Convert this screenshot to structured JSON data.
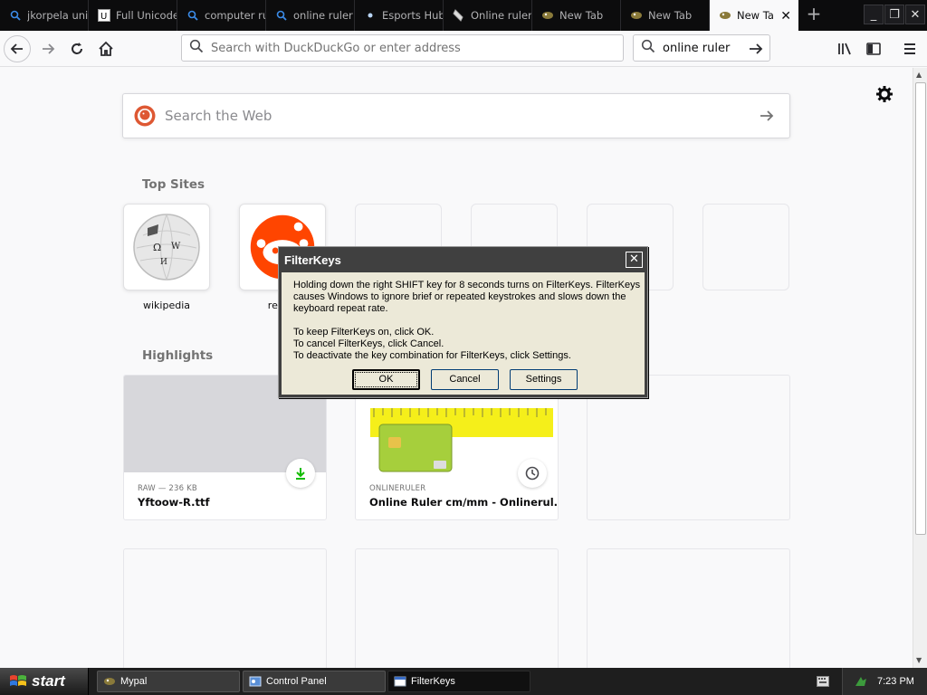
{
  "tabs": [
    {
      "label": "jkorpela unicode",
      "icon": "search-icon"
    },
    {
      "label": "Full Unicode",
      "icon": "unicode-site-icon"
    },
    {
      "label": "computer ruler",
      "icon": "search-icon"
    },
    {
      "label": "online ruler",
      "icon": "search-icon"
    },
    {
      "label": "Esports Hub",
      "icon": "dot-icon"
    },
    {
      "label": "Online ruler",
      "icon": "ruler-site-icon"
    },
    {
      "label": "New Tab",
      "icon": "firefox-icon"
    },
    {
      "label": "New Tab",
      "icon": "firefox-icon"
    },
    {
      "label": "New Tab",
      "icon": "firefox-icon",
      "active": true
    }
  ],
  "navbar": {
    "url_placeholder": "Search with DuckDuckGo or enter address",
    "search_value": "online ruler"
  },
  "newtab": {
    "search_placeholder": "Search the Web",
    "top_sites_title": "Top Sites",
    "top_sites": [
      {
        "label": "wikipedia"
      },
      {
        "label": "reddit"
      },
      {
        "label": ""
      },
      {
        "label": ""
      },
      {
        "label": ""
      },
      {
        "label": ""
      }
    ],
    "highlights_title": "Highlights",
    "highlights": [
      {
        "source": "RAW — 236 KB",
        "title": "Yftoow-R.ttf",
        "badge": "download-icon"
      },
      {
        "source": "ONLINERULER",
        "title": "Online Ruler cm/mm - Onlinerul...",
        "badge": "clock-icon"
      }
    ]
  },
  "dialog": {
    "title": "FilterKeys",
    "paragraph1": "Holding down the right SHIFT key for 8 seconds turns on FilterKeys. FilterKeys causes Windows to ignore brief or repeated keystrokes and slows down the keyboard repeat rate.",
    "paragraph2": "To keep FilterKeys on, click OK.\nTo cancel FilterKeys, click Cancel.\nTo deactivate the key combination for FilterKeys, click Settings.",
    "ok_label": "OK",
    "cancel_label": "Cancel",
    "settings_label": "Settings"
  },
  "taskbar": {
    "start_label": "start",
    "items": [
      {
        "label": "Mypal"
      },
      {
        "label": "Control Panel"
      },
      {
        "label": "FilterKeys",
        "active": true
      }
    ],
    "clock": "7:23 PM"
  },
  "colors": {
    "accent_reddit": "#ff4500",
    "download_green": "#12bc00",
    "ruler_yellow": "#f5ef1a",
    "card_green": "#a6cf3c"
  }
}
